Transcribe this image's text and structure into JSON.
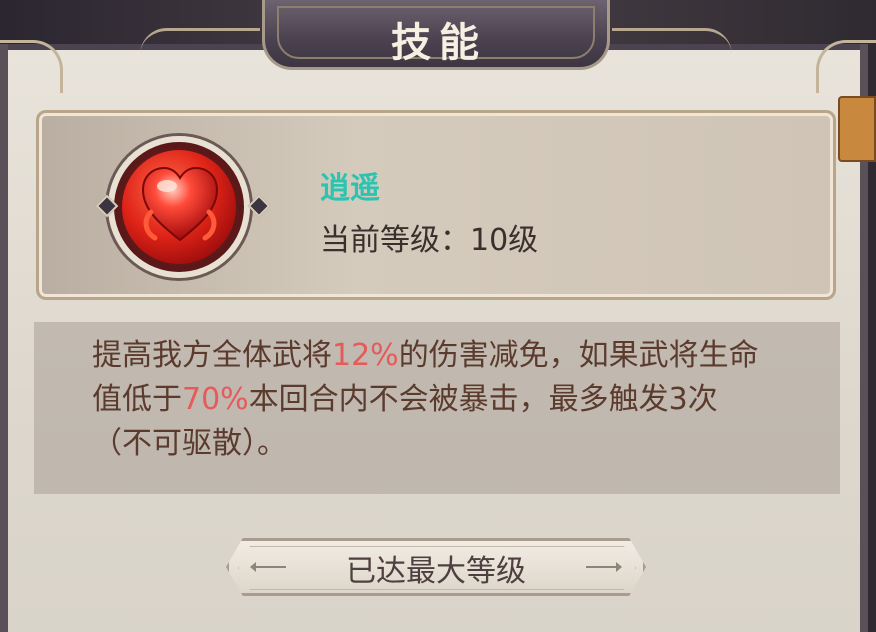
{
  "dialog": {
    "title": "技能"
  },
  "skill": {
    "name": "逍遥",
    "level_text": "当前等级：10级",
    "icon": "heart-icon",
    "name_color": "#2cc4b0"
  },
  "description": {
    "part1": "提高我方全体武将",
    "value1": "12%",
    "part2": "的伤害减免，如果武将生命值低于",
    "value2": "70%",
    "part3": "本回合内不会被暴击，最多触发3次（不可驱散）。",
    "highlight_color": "#e55a5a"
  },
  "button": {
    "label": "已达最大等级"
  }
}
